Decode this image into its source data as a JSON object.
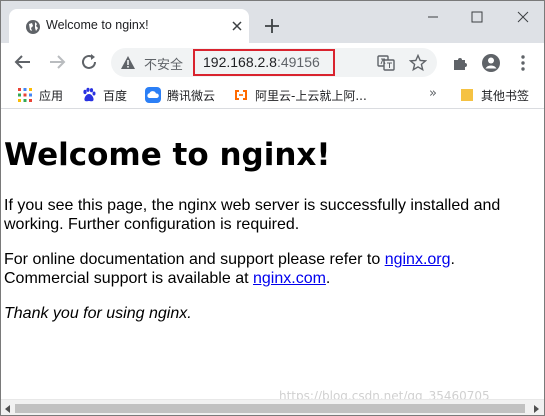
{
  "browser": {
    "tab": {
      "title": "Welcome to nginx!"
    },
    "omnibox": {
      "security_label": "不安全",
      "url_host": "192.168.2.8",
      "url_port": ":49156"
    },
    "bookmarks": [
      {
        "label": "应用"
      },
      {
        "label": "百度"
      },
      {
        "label": "腾讯微云"
      },
      {
        "label": "阿里云-上云就上阿..."
      }
    ],
    "overflow_chevron": "»",
    "other_bookmarks": "其他书签"
  },
  "page": {
    "heading": "Welcome to nginx!",
    "p1": "If you see this page, the nginx web server is successfully installed and working. Further configuration is required.",
    "p2_prefix": "For online documentation and support please refer to ",
    "p2_link1": "nginx.org",
    "p2_mid": ".\nCommercial support is available at ",
    "p2_link2": "nginx.com",
    "p2_suffix": ".",
    "p3": "Thank you for using nginx."
  },
  "watermark": "https://blog.csdn.net/qq_35460705",
  "colors": {
    "highlight_box": "#d9232e",
    "link": "#0000ee",
    "tabstrip": "#dee1e6"
  }
}
